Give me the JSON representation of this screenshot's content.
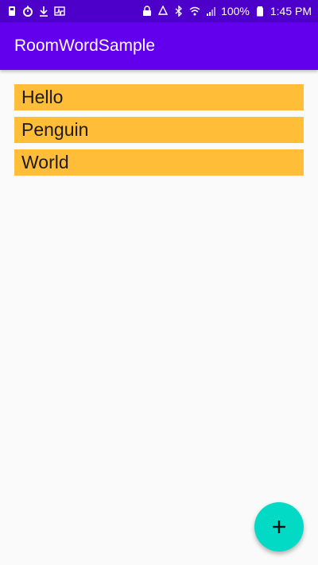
{
  "status_bar": {
    "battery_percent": "100%",
    "time": "1:45 PM",
    "left_icons": [
      "phone-icon",
      "timer-icon",
      "download-icon",
      "activity-icon"
    ],
    "right_icons": [
      "lock-icon",
      "recycle-icon",
      "bluetooth-icon",
      "wifi-icon",
      "signal-icon",
      "battery-icon"
    ]
  },
  "app_bar": {
    "title": "RoomWordSample"
  },
  "words": [
    {
      "text": "Hello"
    },
    {
      "text": "Penguin"
    },
    {
      "text": "World"
    }
  ],
  "fab": {
    "icon": "add-icon"
  },
  "colors": {
    "status_bar": "#4c00c9",
    "app_bar": "#6200ee",
    "item_background": "#ffbd38",
    "fab": "#03dac5",
    "background": "#fafafa"
  }
}
